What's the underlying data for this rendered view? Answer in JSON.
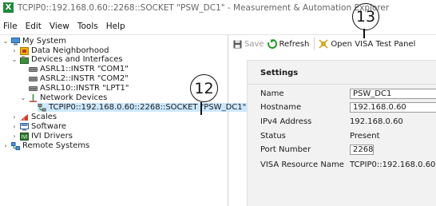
{
  "window": {
    "title": "TCPIP0::192.168.0.60::2268::SOCKET \"PSW_DC1\" - Measurement & Automation Explorer",
    "app_icon": "X"
  },
  "menu": [
    "File",
    "Edit",
    "View",
    "Tools",
    "Help"
  ],
  "tree": {
    "my_system": "My System",
    "data_neighborhood": "Data Neighborhood",
    "devices_and_interfaces": "Devices and Interfaces",
    "asrl1": "ASRL1::INSTR \"COM1\"",
    "asrl2": "ASRL2::INSTR \"COM2\"",
    "asrl10": "ASRL10::INSTR \"LPT1\"",
    "network_devices": "Network Devices",
    "tcpip": "TCPIP0::192.168.0.60::2268::SOCKET \"PSW_DC1\"",
    "scales": "Scales",
    "software": "Software",
    "ivi_drivers": "IVI Drivers",
    "remote_systems": "Remote Systems"
  },
  "toolbar": {
    "save": "Save",
    "refresh": "Refresh",
    "open_visa": "Open VISA Test Panel"
  },
  "settings": {
    "title": "Settings",
    "name_label": "Name",
    "name_value": "PSW_DC1",
    "hostname_label": "Hostname",
    "hostname_value": "192.168.0.60",
    "ipv4_label": "IPv4 Address",
    "ipv4_value": "192.168.0.60",
    "status_label": "Status",
    "status_value": "Present",
    "port_label": "Port Number",
    "port_value": "2268",
    "visa_label": "VISA Resource Name",
    "visa_value": "TCPIP0::192.168.0.60::2268"
  },
  "callouts": {
    "c12": "12",
    "c13": "13"
  },
  "colors": {
    "selection": "#cce8ff",
    "app_icon": "#1e8a3a",
    "panel_bg": "#f2f2f2"
  }
}
